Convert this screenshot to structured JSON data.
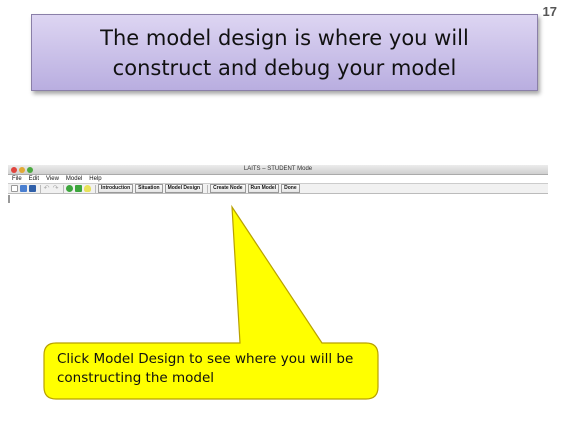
{
  "slide": {
    "number": "17",
    "title": "The model design is where you will\nconstruct and debug your model"
  },
  "app": {
    "window_title": "LAITS – STUDENT Mode",
    "menu": [
      "File",
      "Edit",
      "View",
      "Model",
      "Help"
    ],
    "toolbar_icons": [
      "new-file-icon",
      "open-folder-icon",
      "save-icon",
      "undo-icon",
      "redo-icon",
      "add-node-icon",
      "run-icon",
      "lightbulb-icon"
    ],
    "buttons": {
      "introduction": "Introduction",
      "situation": "Situation",
      "model_design": "Model Design",
      "create_node": "Create Node",
      "run_model": "Run Model",
      "done": "Done"
    }
  },
  "callout": {
    "text": "Click Model Design to see where you will be constructing the model",
    "fill_color": "#ffff00",
    "stroke_color": "#b8a100"
  },
  "colors": {
    "title_box_top": "#ddd5f2",
    "title_box_bottom": "#b9aee0"
  }
}
